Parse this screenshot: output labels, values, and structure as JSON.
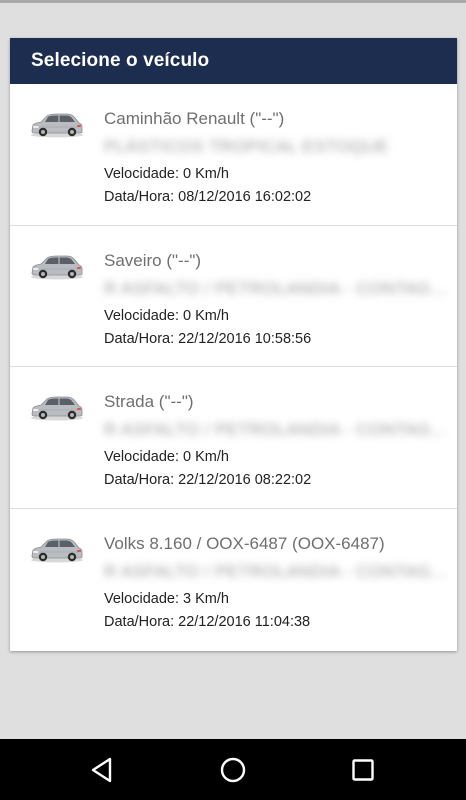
{
  "dialog": {
    "title": "Selecione o veículo"
  },
  "vehicles": [
    {
      "name": "Caminhão Renault (\"--\")",
      "address": "PLÁSTICOS TROPICAL ESTOQUE",
      "speed": "Velocidade: 0 Km/h",
      "datetime": "Data/Hora: 08/12/2016 16:02:02",
      "icon": "car-icon"
    },
    {
      "name": "Saveiro (\"--\")",
      "address": "R ASFALTO / PETROLANDIA - CONTAG...",
      "speed": "Velocidade: 0 Km/h",
      "datetime": "Data/Hora: 22/12/2016 10:58:56",
      "icon": "car-icon"
    },
    {
      "name": "Strada (\"--\")",
      "address": "R ASFALTO / PETROLANDIA - CONTAG...",
      "speed": "Velocidade: 0 Km/h",
      "datetime": "Data/Hora: 22/12/2016 08:22:02",
      "icon": "car-icon"
    },
    {
      "name": "Volks 8.160 / OOX-6487 (OOX-6487)",
      "address": "R ASFALTO / PETROLANDIA - CONTAG...",
      "speed": "Velocidade: 3 Km/h",
      "datetime": "Data/Hora: 22/12/2016 11:04:38",
      "icon": "car-icon"
    }
  ],
  "navbar": {
    "back_icon": "back-triangle-icon",
    "home_icon": "home-circle-icon",
    "recents_icon": "recents-square-icon"
  },
  "colors": {
    "header_bg": "#1c2d4f",
    "page_bg": "#dfdfdf",
    "navbar_bg": "#000000"
  }
}
